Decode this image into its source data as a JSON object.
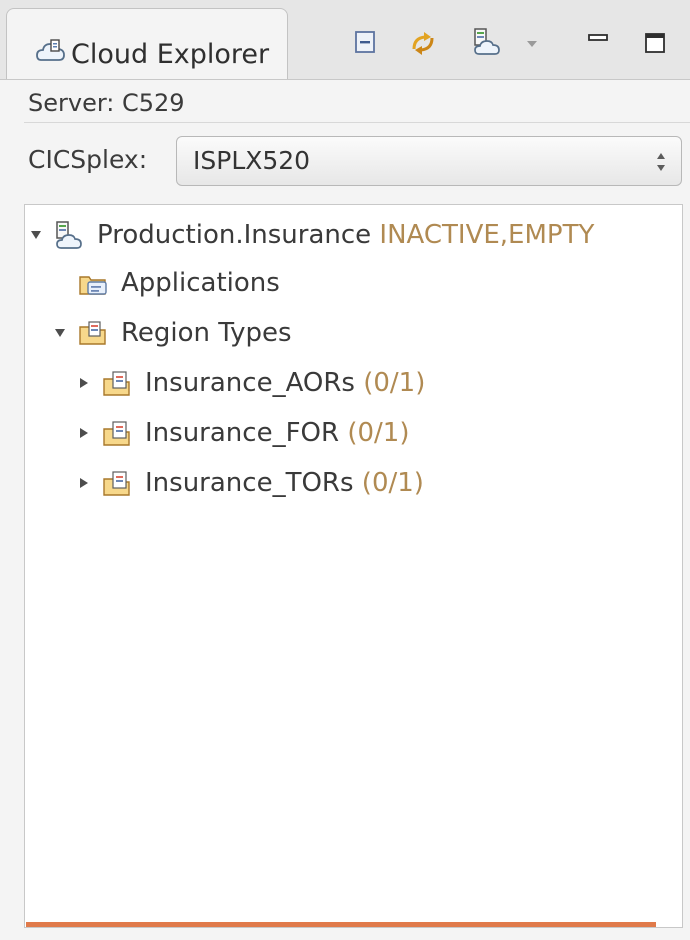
{
  "tab": {
    "label": "Cloud Explorer",
    "icon": "cloud-explorer-icon"
  },
  "toolbar": {
    "collapse_icon": "collapse-all-icon",
    "refresh_icon": "refresh-icon",
    "cloud_icon": "cloud-explorer-icon",
    "dropdown_icon": "view-menu-dropdown-icon",
    "minimize_icon": "minimize-icon",
    "maximize_icon": "maximize-icon"
  },
  "server": {
    "text": "Server: C529"
  },
  "cicsplex": {
    "label": "CICSplex:",
    "value": "ISPLX520"
  },
  "tree": {
    "root": {
      "label": "Production.Insurance",
      "status": "INACTIVE,EMPTY",
      "expanded": true
    },
    "applications": {
      "label": "Applications"
    },
    "region_types": {
      "label": "Region Types",
      "expanded": true
    },
    "items": [
      {
        "label": "Insurance_AORs",
        "count": "(0/1)"
      },
      {
        "label": "Insurance_FOR",
        "count": "(0/1)"
      },
      {
        "label": "Insurance_TORs",
        "count": "(0/1)"
      }
    ]
  },
  "colors": {
    "status_text": "#b08a52",
    "progress_bar": "#e07a4a"
  }
}
